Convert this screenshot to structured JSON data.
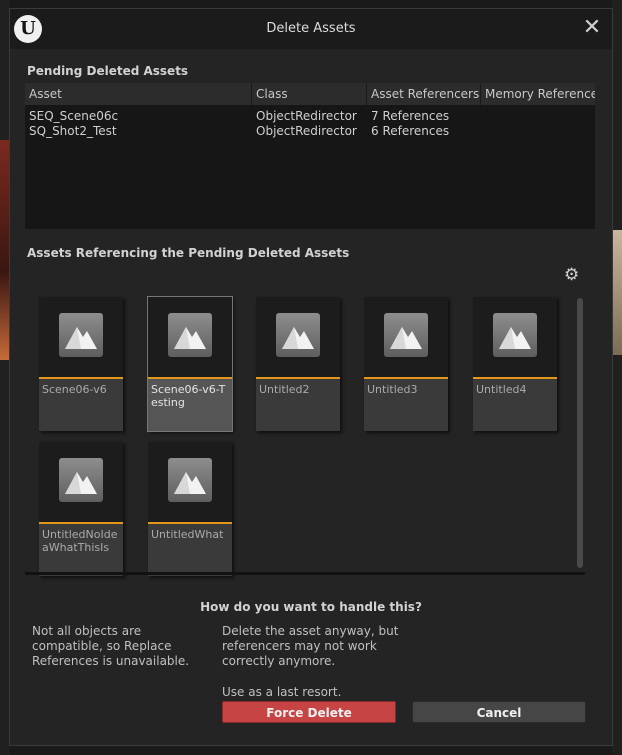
{
  "window": {
    "title": "Delete Assets",
    "logo_letter": "U",
    "close_glyph": "✕"
  },
  "pending": {
    "label": "Pending Deleted Assets",
    "columns": [
      "Asset",
      "Class",
      "Asset Referencers",
      "Memory Reference"
    ],
    "rows": [
      {
        "asset": "SEQ_Scene06c",
        "class": "ObjectRedirector",
        "referencers": "7 References"
      },
      {
        "asset": "SQ_Shot2_Test",
        "class": "ObjectRedirector",
        "referencers": "6 References"
      }
    ]
  },
  "referencing": {
    "label": "Assets Referencing the Pending Deleted Assets",
    "settings_icon": "gear-icon",
    "tiles": [
      {
        "name": "Scene06-v6",
        "selected": false
      },
      {
        "name": "Scene06-v6-Testing",
        "selected": true
      },
      {
        "name": "Untitled2",
        "selected": false
      },
      {
        "name": "Untitled3",
        "selected": false
      },
      {
        "name": "Untitled4",
        "selected": false
      },
      {
        "name": "UntitledNoIdeaWhatThisIs",
        "selected": false
      },
      {
        "name": "UntitledWhat",
        "selected": false
      }
    ]
  },
  "handling": {
    "question": "How do you want to handle this?",
    "left_note": "Not all objects are compatible, so Replace References is unavailable.",
    "right_note": "Delete the asset anyway, but referencers may not work correctly anymore.",
    "last_resort": "Use as a last resort.",
    "force_delete_label": "Force Delete",
    "cancel_label": "Cancel"
  },
  "colors": {
    "accent_orange": "#e3971a",
    "danger_red": "#c74445",
    "dialog_bg": "#242424"
  }
}
